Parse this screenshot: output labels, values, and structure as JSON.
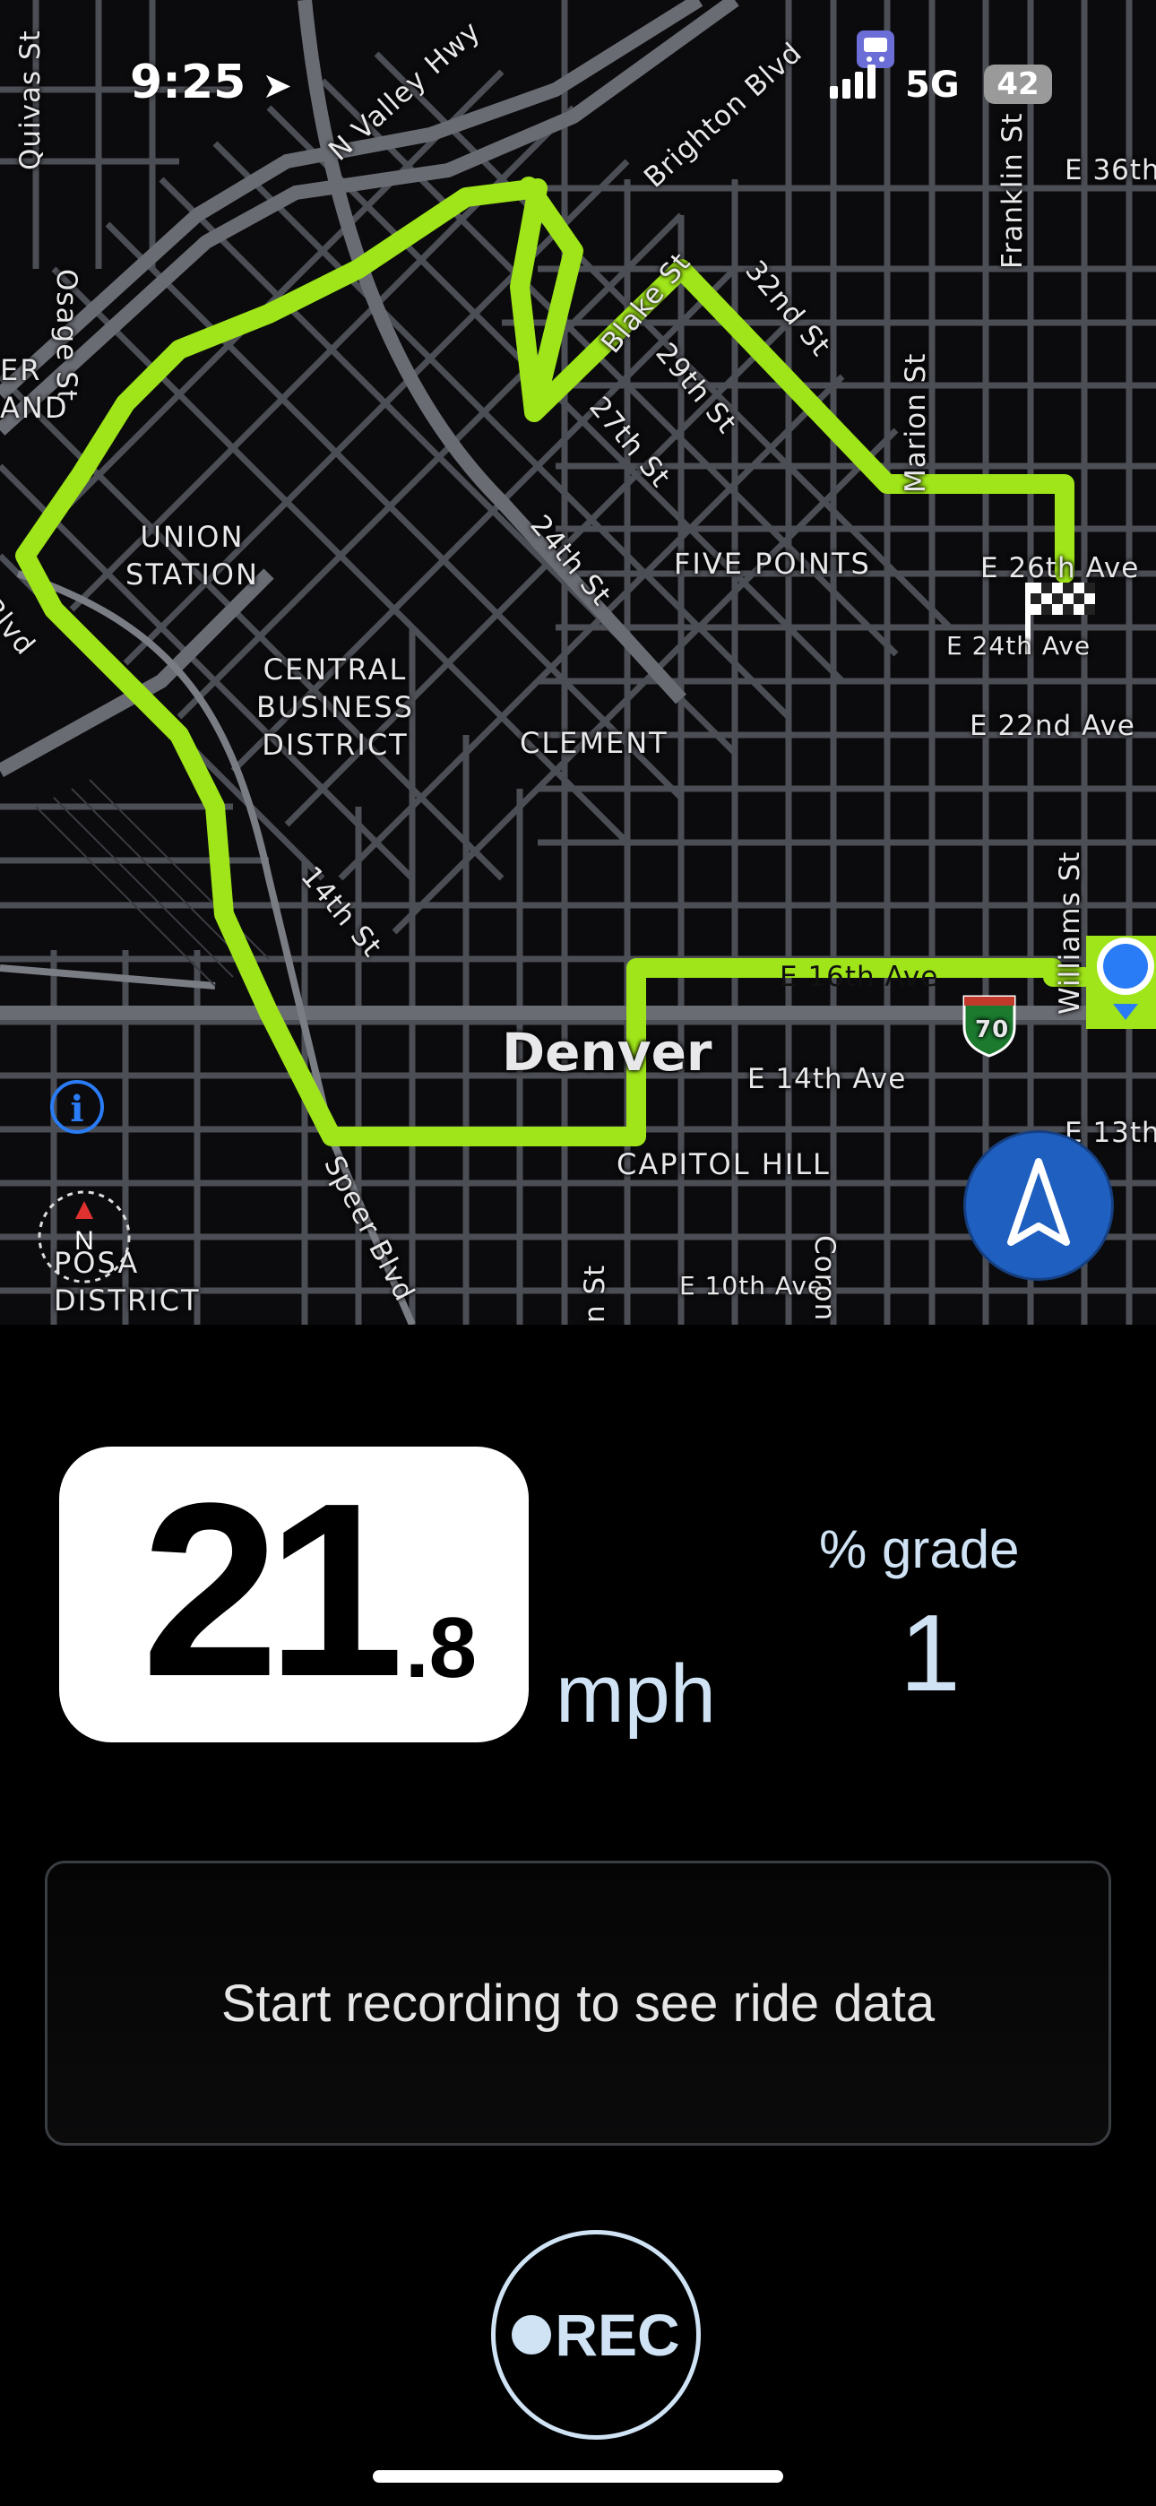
{
  "status_bar": {
    "time": "9:25",
    "network": "5G",
    "battery": "42"
  },
  "map": {
    "city": "Denver",
    "areas": {
      "union_station": "UNION\nSTATION",
      "cbd": "CENTRAL\nBUSINESS\nDISTRICT",
      "five_points": "FIVE POINTS",
      "clement": "CLEMENT",
      "capitol_hill": "CAPITOL HILL",
      "riverside": "ER\nAND",
      "la_alma": "POSA\nDISTRICT"
    },
    "streets": {
      "quivas": "Quivas St",
      "osage": "Osage St",
      "n_valley": "N Valley Hwy",
      "brighton": "Brighton Blvd",
      "franklin": "Franklin St",
      "e36": "E 36th",
      "blake": "Blake St",
      "s32": "32nd St",
      "s29": "29th St",
      "s27": "27th St",
      "marion": "Marion St",
      "s24": "24th St",
      "e26": "E 26th Ave",
      "e24": "E 24th Ave",
      "e22": "E 22nd Ave",
      "blvd": "Blvd",
      "s14": "14th St",
      "williams": "Williams St",
      "e16": "E 16th Ave",
      "e14": "E 14th Ave",
      "e13": "E 13th",
      "speer": "Speer Blvd",
      "e10": "E 10th Ave",
      "n_st": "n St",
      "coron": "Coron"
    },
    "interstate": "70",
    "compass": "N",
    "colors": {
      "route": "#9fe519",
      "location": "#2a7cf6",
      "nav_button": "#1f5fc0"
    }
  },
  "ride": {
    "speed_whole": "21",
    "speed_decimal": ".8",
    "speed_unit": "mph",
    "grade_label": "% grade",
    "grade_value": "1",
    "empty_message": "Start recording to see ride data",
    "rec_label": "REC"
  },
  "icons": [
    "location-arrow-icon",
    "train-icon",
    "signal-icon",
    "info-icon",
    "compass-icon",
    "navigation-arrow-icon",
    "finish-flag-icon",
    "current-location-icon",
    "record-dot-icon"
  ]
}
